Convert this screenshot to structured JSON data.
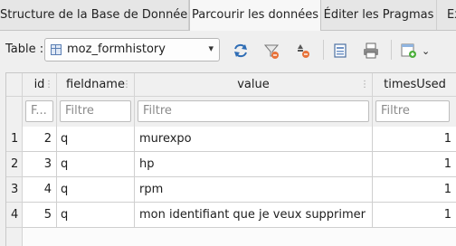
{
  "tabs": [
    {
      "label": "Structure de la Base de Données",
      "active": false
    },
    {
      "label": "Parcourir les données",
      "active": true
    },
    {
      "label": "Éditer les Pragmas",
      "active": false
    },
    {
      "label": "Ex",
      "active": false
    }
  ],
  "toolbar": {
    "table_label": "Table :",
    "table_value": "moz_formhistory",
    "icons": [
      "refresh-icon",
      "clear-filters-icon",
      "clear-sorting-icon",
      "save-table-icon",
      "print-icon",
      "insert-record-icon"
    ]
  },
  "grid": {
    "columns": [
      "id",
      "fieldname",
      "value",
      "timesUsed"
    ],
    "filter_placeholders": [
      "Filtre",
      "Filtre",
      "Filtre",
      "Filtre"
    ],
    "filter_id_display": "F...",
    "rows": [
      {
        "num": "1",
        "id": "2",
        "fieldname": "q",
        "value": "murexpo",
        "timesUsed": "1"
      },
      {
        "num": "2",
        "id": "3",
        "fieldname": "q",
        "value": "hp",
        "timesUsed": "1"
      },
      {
        "num": "3",
        "id": "4",
        "fieldname": "q",
        "value": "rpm",
        "timesUsed": "1"
      },
      {
        "num": "4",
        "id": "5",
        "fieldname": "q",
        "value": "mon identifiant que je veux supprimer",
        "timesUsed": "1"
      }
    ]
  },
  "colors": {
    "accent": "#3a6fb0",
    "toolbar_bg": "#efefef",
    "grid_header_bg": "#f0f0f0"
  }
}
